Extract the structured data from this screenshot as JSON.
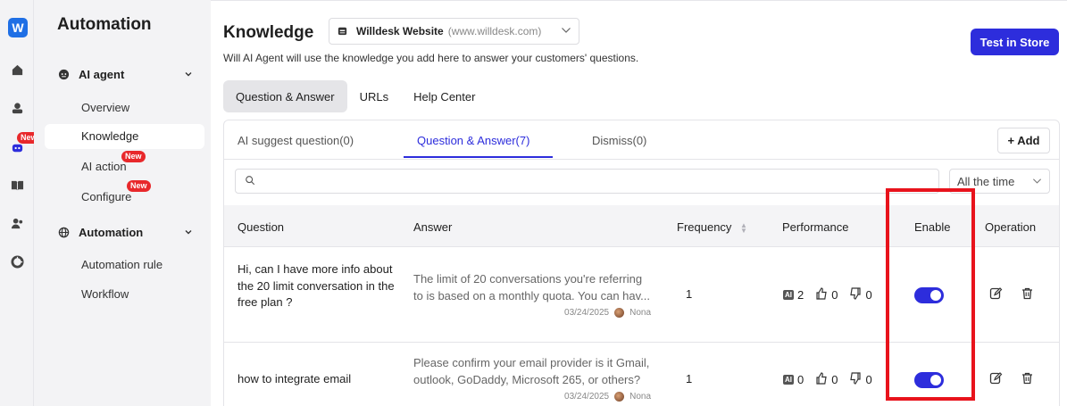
{
  "rail": {
    "logo": "W",
    "new_badge": "New"
  },
  "menu": {
    "title": "Automation",
    "groups": [
      {
        "label": "AI agent",
        "items": [
          "Overview",
          "Knowledge",
          "AI action",
          "Configure"
        ]
      },
      {
        "label": "Automation",
        "items": [
          "Automation rule",
          "Workflow"
        ]
      }
    ],
    "new_badge": "New"
  },
  "header": {
    "title": "Knowledge",
    "site_name": "Willdesk Website",
    "site_url": "(www.willdesk.com)",
    "subtitle": "Will AI Agent will use the knowledge you add here to answer your customers' questions.",
    "test_button": "Test in Store"
  },
  "tabs": [
    "Question & Answer",
    "URLs",
    "Help Center"
  ],
  "subtabs": [
    "AI suggest question(0)",
    "Question & Answer(7)",
    "Dismiss(0)"
  ],
  "add_button": "+ Add",
  "search": {
    "placeholder": ""
  },
  "time_filter": "All the time",
  "table": {
    "headers": [
      "Question",
      "Answer",
      "Frequency",
      "Performance",
      "Enable",
      "Operation"
    ],
    "rows": [
      {
        "question": "Hi, can I have more info about the 20 limit conversation in the free plan ?",
        "answer_line1": "The limit of 20 conversations you're referring",
        "answer_line2": "to is based on a monthly quota. You can hav...",
        "date": "03/24/2025",
        "author": "Nona",
        "frequency": "1",
        "ai": "AI",
        "ai_count": "2",
        "likes": "0",
        "dislikes": "0",
        "enabled": true
      },
      {
        "question": "how to integrate email",
        "answer_line1": "Please confirm your email provider is it Gmail,",
        "answer_line2": "outlook, GoDaddy, Microsoft 265, or others?",
        "date": "03/24/2025",
        "author": "Nona",
        "frequency": "1",
        "ai": "AI",
        "ai_count": "0",
        "likes": "0",
        "dislikes": "0",
        "enabled": true
      }
    ]
  },
  "colors": {
    "accent": "#2d2ddc",
    "highlight": "#e8131c",
    "badge": "#e8282b"
  }
}
